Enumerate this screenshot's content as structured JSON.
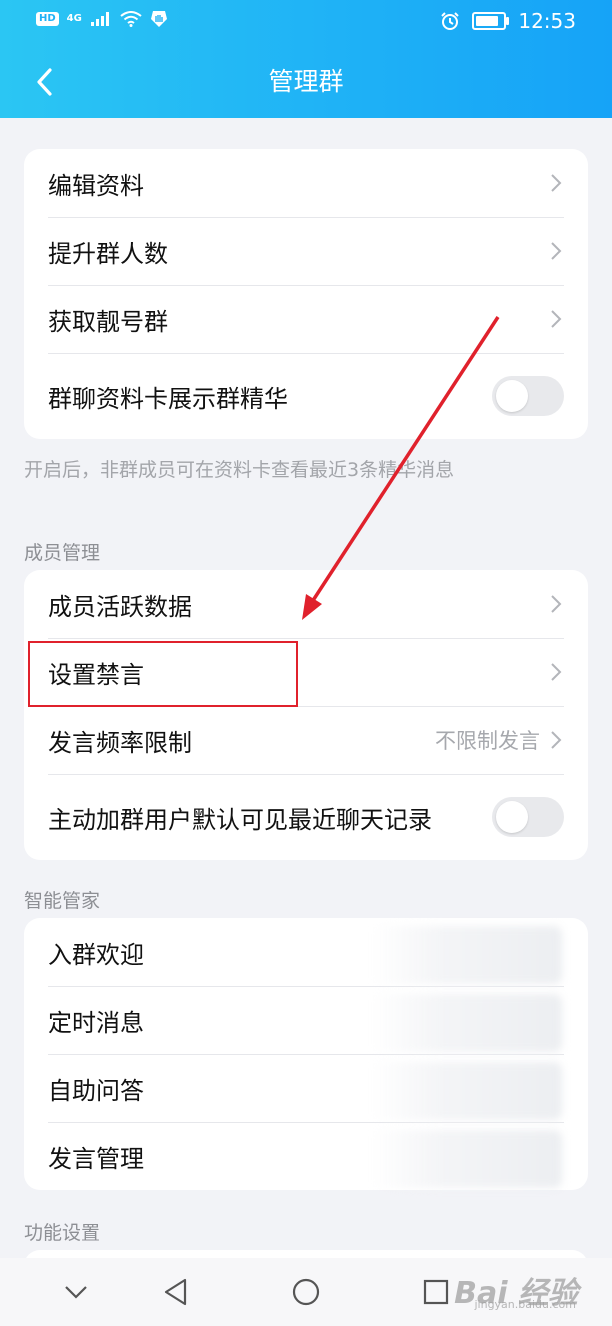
{
  "status_bar": {
    "hd_badge": "HD",
    "network": "4G",
    "time": "12:53"
  },
  "header": {
    "back_icon": "chevron-left-icon",
    "title": "管理群"
  },
  "group_card": {
    "items": [
      {
        "label": "编辑资料"
      },
      {
        "label": "提升群人数"
      },
      {
        "label": "获取靓号群"
      },
      {
        "label": "群聊资料卡展示群精华",
        "toggle": false
      }
    ]
  },
  "group_hint": "开启后，非群成员可在资料卡查看最近3条精华消息",
  "member_section": {
    "title": "成员管理",
    "items": [
      {
        "label": "成员活跃数据"
      },
      {
        "label": "设置禁言"
      },
      {
        "label": "发言频率限制",
        "value": "不限制发言"
      },
      {
        "label": "主动加群用户默认可见最近聊天记录",
        "toggle": false
      }
    ]
  },
  "smart_section": {
    "title": "智能管家",
    "items": [
      {
        "label": "入群欢迎"
      },
      {
        "label": "定时消息"
      },
      {
        "label": "自助问答"
      },
      {
        "label": "发言管理"
      }
    ]
  },
  "function_section": {
    "title": "功能设置"
  },
  "nav_bar": {
    "icons": [
      "chevron-down-icon",
      "back-triangle-icon",
      "home-circle-icon",
      "recents-square-icon"
    ]
  },
  "watermark": {
    "text": "Bai 经验",
    "sub": "jingyan.baidu.com"
  },
  "colors": {
    "header_start": "#2bc6f3",
    "header_end": "#16a3f7",
    "annotation": "#e0212c",
    "background": "#f2f3f7"
  }
}
